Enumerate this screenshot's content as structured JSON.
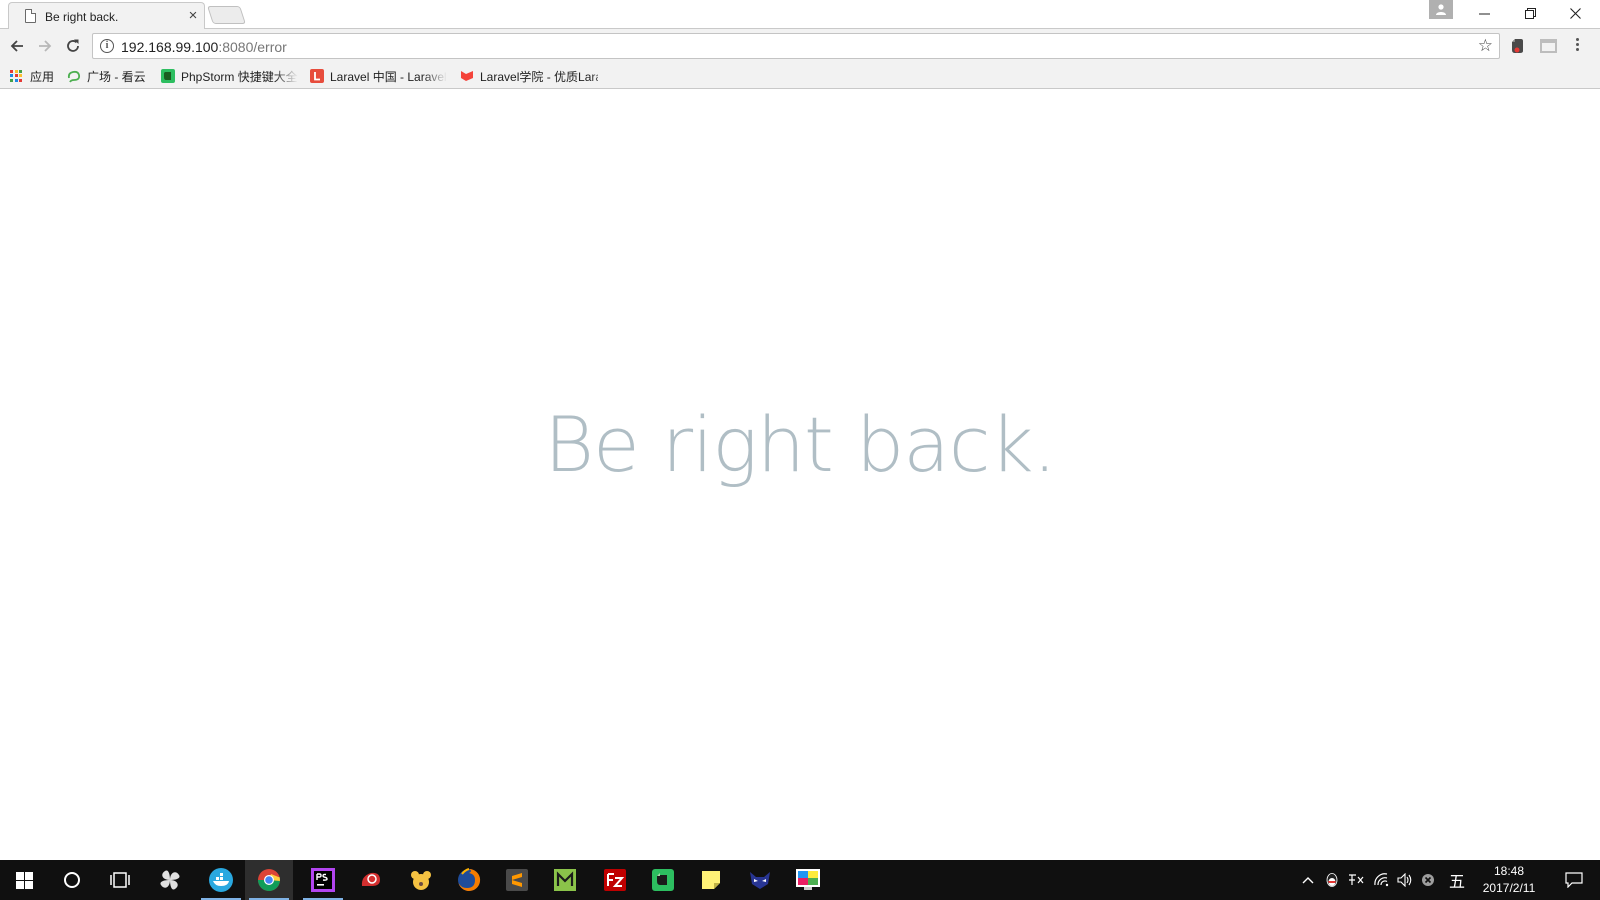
{
  "browser": {
    "tab": {
      "title": "Be right back.",
      "close_glyph": "×"
    },
    "window_controls": {
      "minimize": "minimize-icon",
      "maximize": "restore-icon",
      "close": "close-icon"
    },
    "address": {
      "host": "192.168.99.100",
      "rest": ":8080/error"
    },
    "toolbar_icons": [
      "back-icon",
      "forward-icon",
      "reload-icon",
      "info-icon",
      "star-icon",
      "evernote-extension-icon",
      "extension-icon",
      "menu-icon"
    ],
    "bookmarks": [
      {
        "label": "应用",
        "icon": "apps-grid-icon"
      },
      {
        "label": "广场 - 看云",
        "icon": "kancloud-icon",
        "color": "#4caf50"
      },
      {
        "label": "PhpStorm 快捷键大全",
        "icon": "evernote-icon",
        "color": "#2dbe60"
      },
      {
        "label": "Laravel 中国 - Laravel",
        "icon": "laravel-l-icon",
        "color": "#e74c3c"
      },
      {
        "label": "Laravel学院 - 优质Laravel",
        "icon": "laravel-logo-icon",
        "color": "#f4433a"
      }
    ]
  },
  "page": {
    "message": "Be right back.",
    "message_color": "#b0bec5"
  },
  "taskbar": {
    "apps": [
      {
        "name": "start-icon"
      },
      {
        "name": "cortana-icon"
      },
      {
        "name": "task-view-icon"
      },
      {
        "name": "pinwheel-app-icon"
      },
      {
        "name": "docker-icon",
        "running": true
      },
      {
        "name": "chrome-icon",
        "running": true,
        "active": true
      },
      {
        "name": "phpstorm-icon",
        "running": true
      },
      {
        "name": "snail-app-icon"
      },
      {
        "name": "bear-app-icon"
      },
      {
        "name": "firefox-icon"
      },
      {
        "name": "sublime-text-icon"
      },
      {
        "name": "markdown-editor-icon"
      },
      {
        "name": "filezilla-icon"
      },
      {
        "name": "evernote-icon"
      },
      {
        "name": "sticky-notes-icon"
      },
      {
        "name": "hero-mask-icon"
      },
      {
        "name": "color-monitor-icon"
      }
    ],
    "tray": {
      "ime_label": "五",
      "time": "18:48",
      "date": "2017/2/11"
    }
  }
}
